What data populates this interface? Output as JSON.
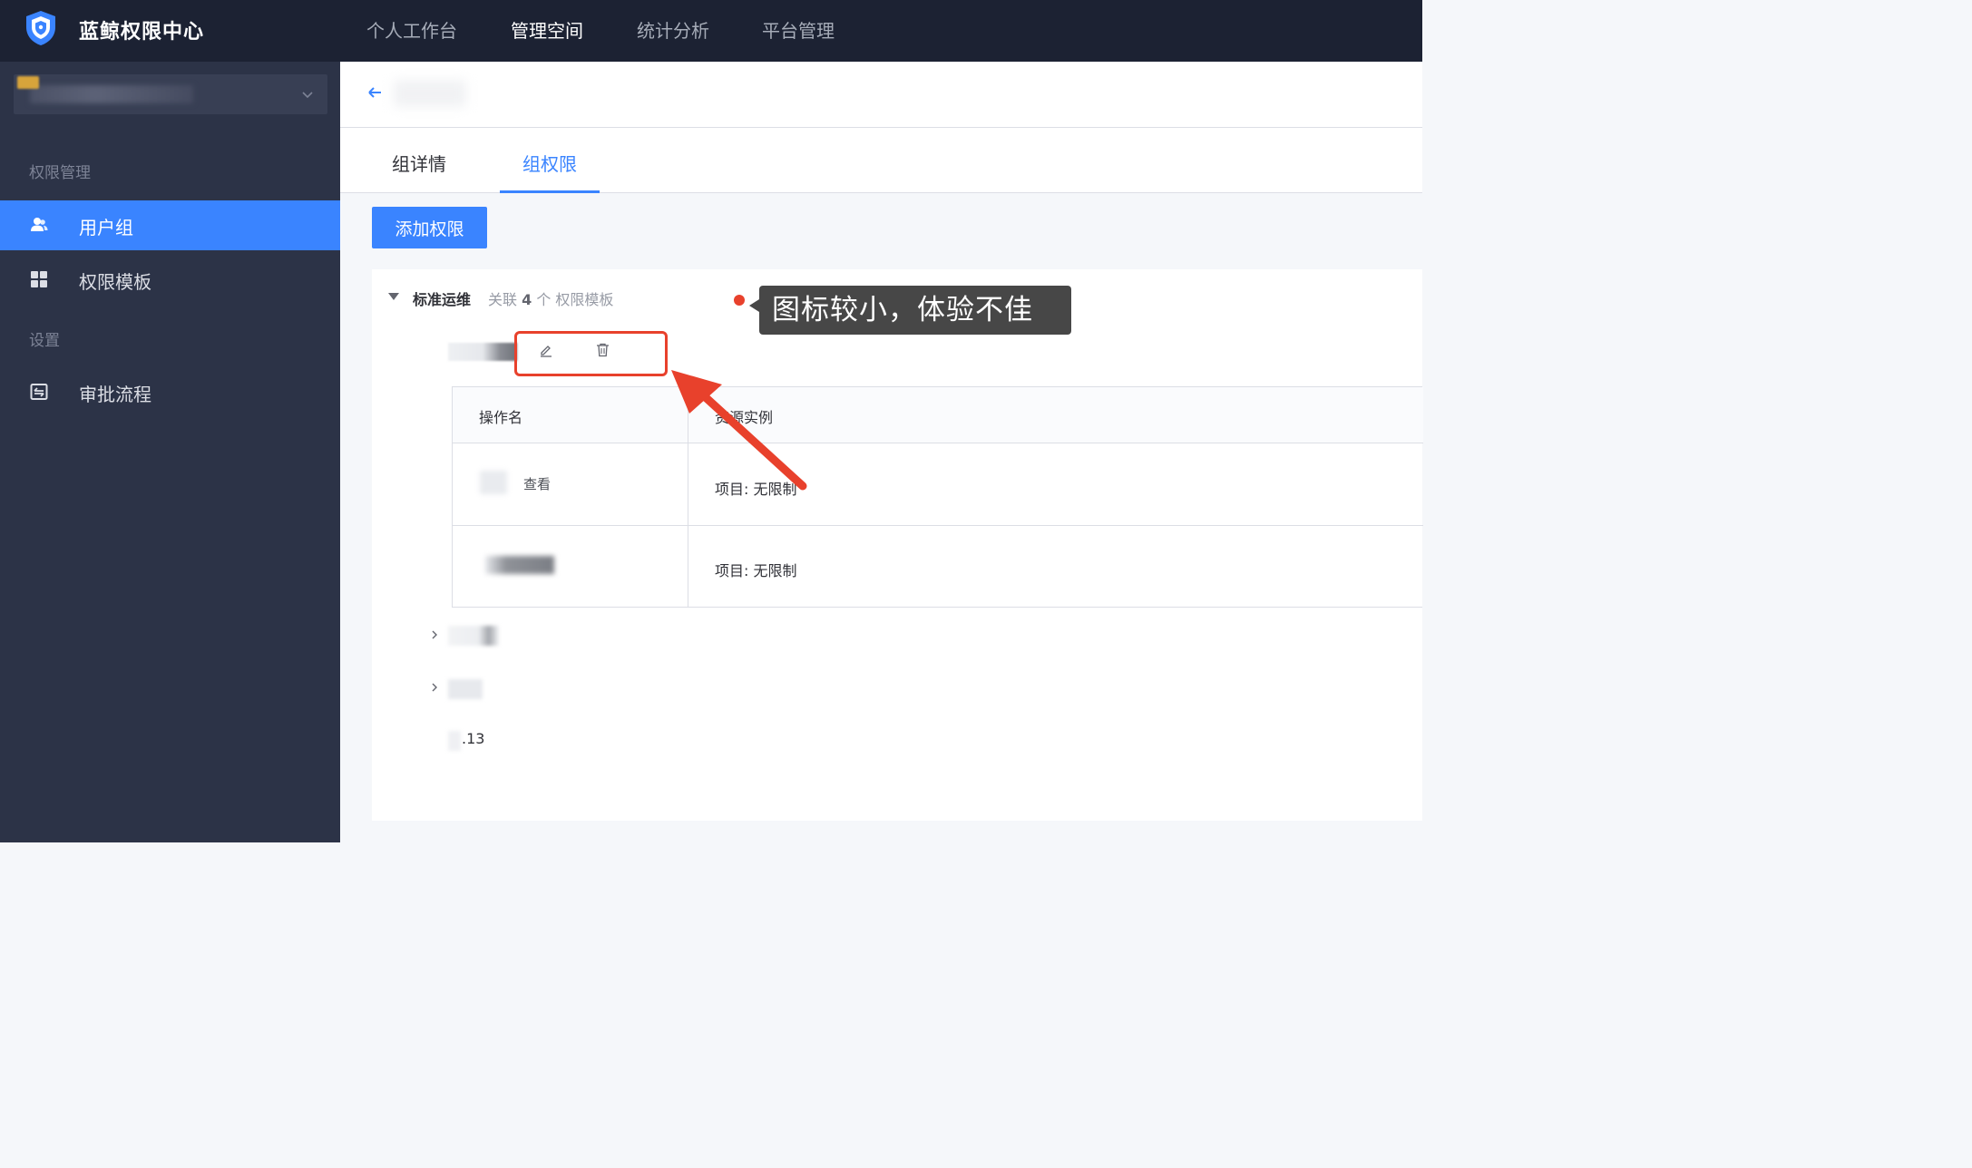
{
  "app": {
    "title": "蓝鲸权限中心"
  },
  "top_nav": [
    {
      "label": "个人工作台",
      "active": false
    },
    {
      "label": "管理空间",
      "active": true
    },
    {
      "label": "统计分析",
      "active": false
    },
    {
      "label": "平台管理",
      "active": false
    }
  ],
  "sidebar": {
    "groups": [
      {
        "label": "权限管理",
        "items": [
          {
            "label": "用户组",
            "icon": "user-group-icon",
            "active": true
          },
          {
            "label": "权限模板",
            "icon": "grid-icon",
            "active": false
          }
        ]
      },
      {
        "label": "设置",
        "items": [
          {
            "label": "审批流程",
            "icon": "approval-icon",
            "active": false
          }
        ]
      }
    ]
  },
  "tabs": [
    {
      "label": "组详情",
      "active": false
    },
    {
      "label": "组权限",
      "active": true
    }
  ],
  "actions": {
    "add_permission": "添加权限"
  },
  "permission_group": {
    "name": "标准运维",
    "meta_prefix": "关联",
    "meta_count": "4",
    "meta_suffix": "个 权限模板",
    "table": {
      "columns": [
        "操作名",
        "资源实例"
      ],
      "rows": [
        {
          "action": "查看",
          "resource": "项目: 无限制"
        },
        {
          "action": "",
          "resource": "项目: 无限制"
        }
      ]
    },
    "tail_text": ".13"
  },
  "annotation": {
    "text": "图标较小，体验不佳",
    "color": "#e8412c"
  },
  "colors": {
    "primary": "#3a84ff",
    "topbar": "#1c2233",
    "sidebar": "#2c3347"
  }
}
